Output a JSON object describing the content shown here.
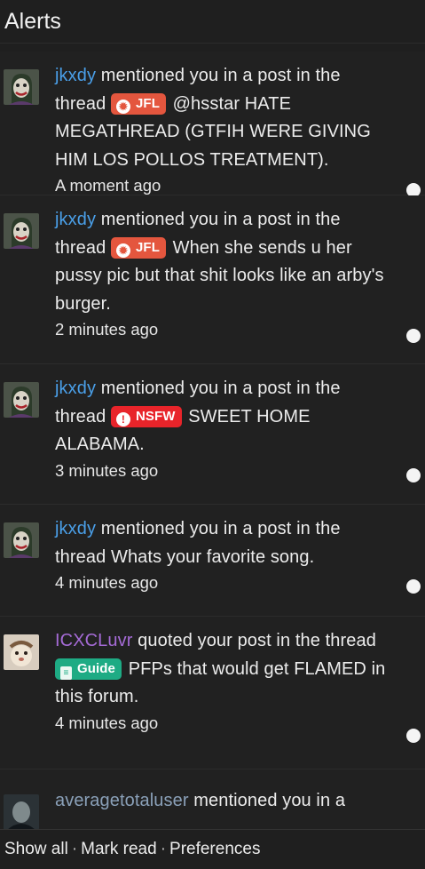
{
  "header": {
    "title": "Alerts"
  },
  "alerts": [
    {
      "user": "jkxdy",
      "action": "mentioned you in a post in the thread",
      "badge": {
        "label": "JFL",
        "icon": "flame-icon"
      },
      "thread": "@hsstar HATE MEGATHREAD (GTFIH WERE GIVING HIM LOS POLLOS TREATMENT).",
      "time": "A moment ago",
      "avatar": "joker-avatar"
    },
    {
      "user": "jkxdy",
      "action": "mentioned you in a post in the thread",
      "badge": {
        "label": "JFL",
        "icon": "flame-icon"
      },
      "thread": "When she sends u her pussy pic but that shit looks like an arby's burger.",
      "time": "2 minutes ago",
      "avatar": "joker-avatar"
    },
    {
      "user": "jkxdy",
      "action": "mentioned you in a post in the thread",
      "badge": {
        "label": "NSFW",
        "icon": "exclamation-icon"
      },
      "thread": "SWEET HOME ALABAMA.",
      "time": "3 minutes ago",
      "avatar": "joker-avatar"
    },
    {
      "user": "jkxdy",
      "action": "mentioned you in a post in the thread",
      "thread": "Whats your favorite song.",
      "time": "4 minutes ago",
      "avatar": "joker-avatar"
    },
    {
      "user": "ICXCLuvr",
      "action": "quoted your post in the thread",
      "badge": {
        "label": "Guide",
        "icon": "book-icon"
      },
      "thread": "PFPs that would get FLAMED in this forum.",
      "time": "4 minutes ago",
      "avatar": "plush-avatar"
    },
    {
      "user": "averagetotaluser",
      "action": "mentioned you in a",
      "avatar": "dark-avatar"
    }
  ],
  "footer": {
    "show_all": "Show all",
    "mark_read": "Mark read",
    "preferences": "Preferences",
    "separator": "·"
  },
  "colors": {
    "background": "#1f1f1f",
    "username_blue": "#4a9fe8",
    "username_purple": "#a56bd6",
    "badge_jfl": "#e4563e",
    "badge_nsfw": "#e8242a",
    "badge_guide": "#1eab84"
  }
}
